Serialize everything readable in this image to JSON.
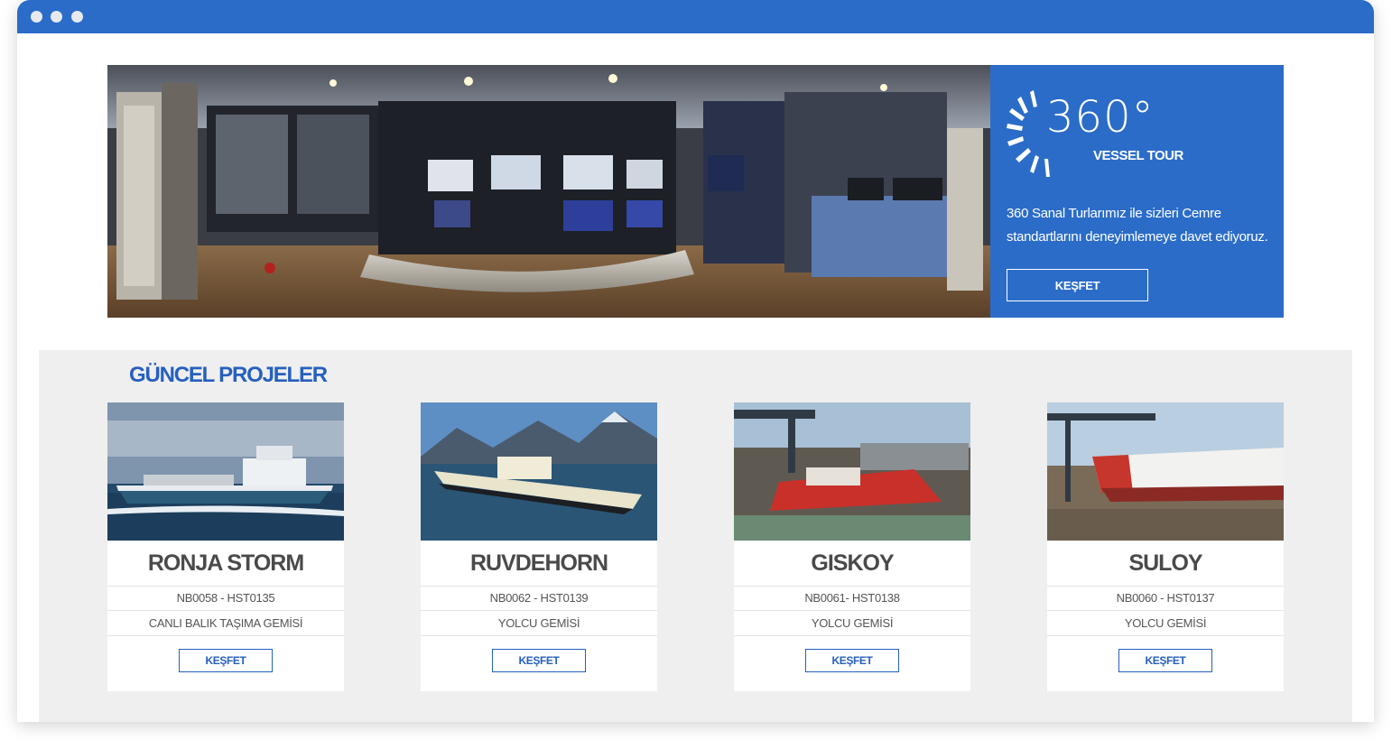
{
  "colors": {
    "titlebar": "#2b6cc8",
    "accent": "#2660be",
    "panel": "#2b6cc8",
    "section_bg": "#efefef"
  },
  "hero": {
    "logo_number": "360°",
    "logo_caption": "VESSEL TOUR",
    "description": "360 Sanal Turlarımız ile sizleri Cemre standartlarını deneyimlemeye davet ediyoruz.",
    "button_label": "KEŞFET"
  },
  "projects": {
    "title": "GÜNCEL PROJELER",
    "items": [
      {
        "name": "RONJA STORM",
        "code": "NB0058 - HST0135",
        "type": "CANLI BALIK TAŞIMA GEMİSİ",
        "button_label": "KEŞFET"
      },
      {
        "name": "RUVDEHORN",
        "code": "NB0062 - HST0139",
        "type": "YOLCU GEMİSİ",
        "button_label": "KEŞFET"
      },
      {
        "name": "GISKOY",
        "code": "NB0061- HST0138",
        "type": "YOLCU GEMİSİ",
        "button_label": "KEŞFET"
      },
      {
        "name": "SULOY",
        "code": "NB0060 - HST0137",
        "type": "YOLCU GEMİSİ",
        "button_label": "KEŞFET"
      }
    ]
  }
}
